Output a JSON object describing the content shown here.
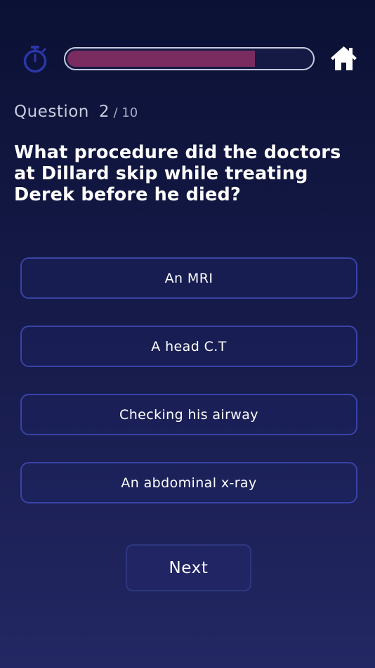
{
  "header": {
    "timer_icon": "stopwatch-icon",
    "home_icon": "home-icon",
    "progress_fraction": 0.77,
    "colors": {
      "progress_fill": "#7a2c60",
      "accent_icon": "#2b36a8"
    }
  },
  "question": {
    "label": "Question",
    "number": "2",
    "total": "/ 10",
    "text": "What procedure did the doctors at Dillard skip while treating Derek before he died?"
  },
  "answers": [
    {
      "label": "An MRI"
    },
    {
      "label": "A head C.T"
    },
    {
      "label": "Checking his airway"
    },
    {
      "label": "An abdominal x-ray"
    }
  ],
  "footer": {
    "next_label": "Next"
  }
}
